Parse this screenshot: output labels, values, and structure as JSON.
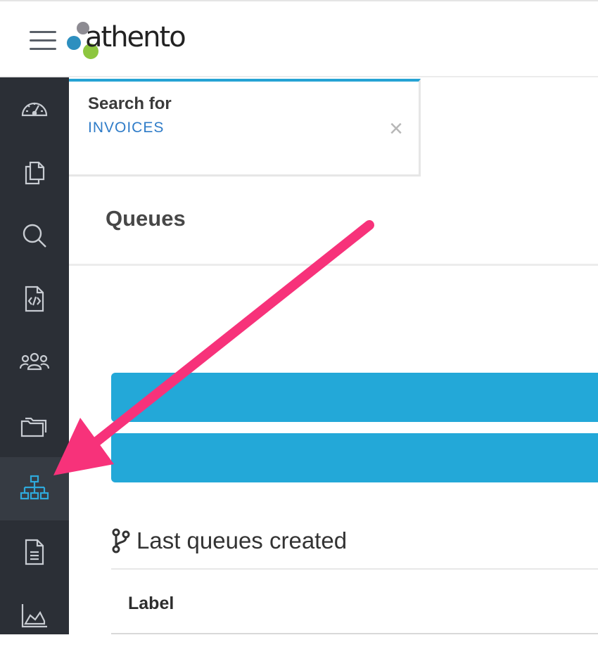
{
  "header": {
    "logo_text": "athento"
  },
  "sidebar": {
    "items": [
      {
        "name": "dashboard",
        "icon": "speedometer-icon",
        "active": false
      },
      {
        "name": "documents",
        "icon": "copy-documents-icon",
        "active": false
      },
      {
        "name": "search",
        "icon": "search-icon",
        "active": false
      },
      {
        "name": "code-file",
        "icon": "file-code-icon",
        "active": false
      },
      {
        "name": "users",
        "icon": "users-group-icon",
        "active": false
      },
      {
        "name": "folders",
        "icon": "folders-icon",
        "active": false
      },
      {
        "name": "queues",
        "icon": "sitemap-icon",
        "active": true
      },
      {
        "name": "forms",
        "icon": "file-text-icon",
        "active": false
      },
      {
        "name": "stats",
        "icon": "area-chart-icon",
        "active": false
      }
    ]
  },
  "search_card": {
    "title": "Search for",
    "term": "INVOICES",
    "close_label": "×"
  },
  "page": {
    "title": "Queues"
  },
  "section": {
    "title": "Last queues created",
    "table_header": "Label"
  },
  "colors": {
    "sidebar_bg": "#2b2f36",
    "accent_blue": "#23a8d8",
    "arrow_pink": "#f7327a",
    "link_blue": "#2f7cc8"
  }
}
